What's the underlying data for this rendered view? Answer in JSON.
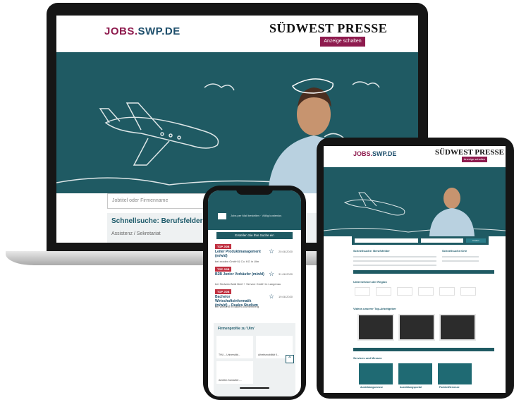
{
  "laptop": {
    "logo_jobs": "JOBS.",
    "logo_swp": "SWP.DE",
    "brand": "SÜDWEST PRESSE",
    "cta": "Anzeige schalten",
    "search_placeholder": "Jobtitel oder Firmenname",
    "quick_title": "Schnellsuche: Berufsfelder",
    "quick_item": "Assistenz / Sekretariat"
  },
  "tablet": {
    "logo_jobs": "JOBS.",
    "logo_swp": "SWP.DE",
    "brand": "SÜDWEST PRESSE",
    "cta": "Anzeige schalten",
    "search_btn": "Finden",
    "sec1": "Schnellsuche: Berufsfelder",
    "sec2": "Schnellsuche:Orte",
    "sec3": "Unternehmen der Region",
    "sec4": "Videos unserer Top-Arbeitgeber",
    "sec5": "Services und Messen",
    "tiles": [
      {
        "label": "Ausbildungsmesse"
      },
      {
        "label": "Ausbildungsportal"
      },
      {
        "label": "Fachkräftemesse"
      }
    ]
  },
  "phone": {
    "mail_text": "Jobs per Mail bestellen · Völlig kostenlos",
    "save_search": "Erstellen Sie Ihre Suche ein",
    "jobs": [
      {
        "badge": "TOP JOB",
        "title": "Leiter Produktmanagement (m/w/d)",
        "date": "20.08.2020",
        "company": "bei xxxden GmbH & Co. KG in Ulm"
      },
      {
        "badge": "TOP JOB",
        "title": "B2B Junior Verkäufer (m/w/d)",
        "date": "31.08.2020",
        "company": "bei Südwest Mail Brief + Service GmbH in Langenau"
      },
      {
        "badge": "TOP JOB",
        "title": "Bachelor Wirtschaftsinformatik (m/w/d) – Duales Studium",
        "date": "19.08.2020",
        "company": "bei Wieland in Baden-Württemberg"
      }
    ],
    "profiles_title": "Firmenprofile zu 'Ulm'",
    "profiles": [
      {
        "name": "THU – Universität..."
      },
      {
        "name": "Arbeitsmobilität K..."
      },
      {
        "name": "Arbeiter-Samariter-..."
      }
    ],
    "up_arrow": "⌃"
  }
}
